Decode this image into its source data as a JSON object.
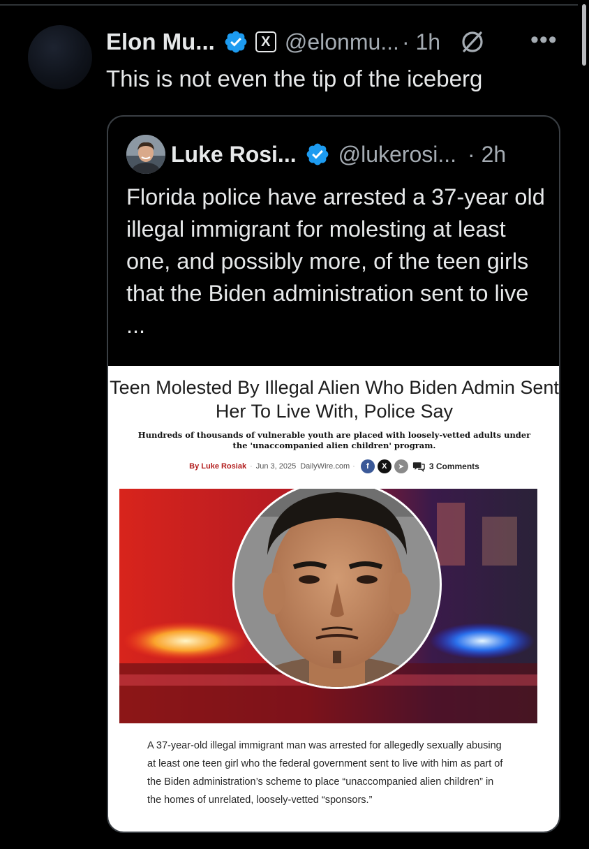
{
  "tweet": {
    "author_name": "Elon Mu...",
    "x_badge": "X",
    "handle": "@elonmu...",
    "time": "· 1h",
    "more": "•••",
    "text": "This is not even the tip of the iceberg"
  },
  "quote": {
    "author_name": "Luke Rosi...",
    "handle": "@lukerosi...",
    "time": "· 2h",
    "text": "Florida police have arrested a 37-year old illegal immigrant for molesting at least one, and possibly more, of the teen girls that the Biden administration sent to live ..."
  },
  "article": {
    "headline": "Teen Molested By Illegal Alien Who Biden Admin Sent Her To Live With, Police Say",
    "subheadline": "Hundreds of thousands of vulnerable youth are placed with loosely-vetted adults under the 'unaccompanied alien children' program.",
    "author": "By Luke Rosiak",
    "date": "Jun 3, 2025",
    "source": "DailyWire.com",
    "share_facebook": "f",
    "share_x": "X",
    "share_telegram": "➤",
    "comments": "3 Comments",
    "caption": "A 37-year-old illegal immigrant man was arrested for allegedly sexually abusing at least one teen girl who the federal government sent to live with him as part of the Biden administration’s scheme to place “unaccompanied alien children” in the homes of unrelated, loosely-vetted “sponsors.”"
  },
  "colors": {
    "background": "#000000",
    "verified_blue": "#1d9bf0",
    "secondary_text": "#a5acb3",
    "author_red": "#b21b1b"
  }
}
